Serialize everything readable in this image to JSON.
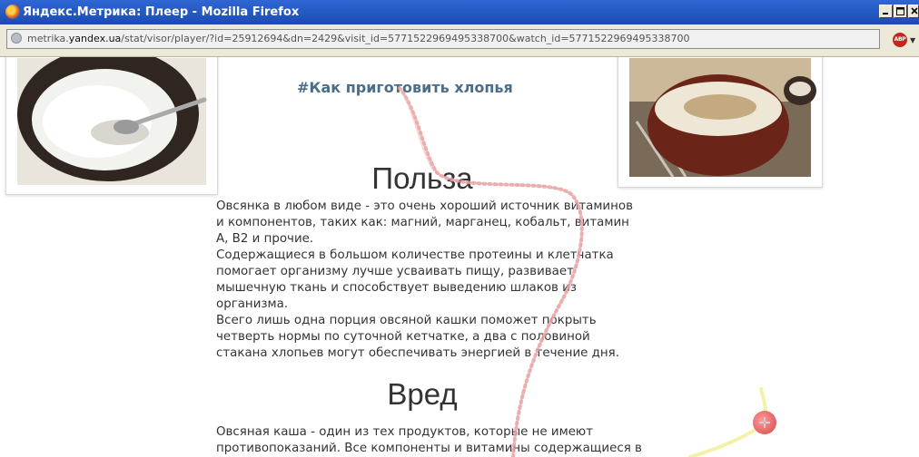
{
  "window": {
    "title": "Яндекс.Метрика: Плеер - Mozilla Firefox"
  },
  "navbar": {
    "url_prefix": "metrika.",
    "url_host": "yandex.ua",
    "url_rest": "/stat/visor/player/?id=25912694&dn=2429&visit_id=5771522969495338700&watch_id=5771522969495338700",
    "abp_label": "ABP"
  },
  "content": {
    "hashtag": "#Как приготовить хлопья",
    "benefit_heading": "Польза",
    "benefit_lines": [
      "Овсянка в любом виде - это очень хороший источник витаминов",
      "и компонентов, таких как: магний, марганец, кобальт, витамин",
      "A, B2 и прочие.",
      "Содержащиеся в большом количестве протеины  и клетчатка",
      "помогает организму лучше усваивать пищу, развивает",
      "мышечную ткань и способствует выведению шлаков из",
      "организма.",
      "Всего лишь одна порция овсяной кашки поможет покрыть",
      "четверть нормы по суточной кетчатке, а два с половиной",
      "стакана хлопьев могут обеспечивать энергией в течение дня."
    ],
    "harm_heading": "Вред",
    "harm_lines": [
      "Овсяная каша - один из тех продуктов, которые не имеют",
      "противопоказаний. Все компоненты и витамины содержащиеся в"
    ]
  },
  "icons": {
    "browser": "firefox-icon",
    "address": "globe-icon",
    "adblock": "adblock-plus-icon",
    "cursor": "crosshair-cursor-icon"
  },
  "colors": {
    "titlebar": "#1f55c4",
    "link": "#4a6e8a",
    "text": "#333333",
    "track_red": "#e8a0a0",
    "track_yellow": "#f5f0a0"
  }
}
